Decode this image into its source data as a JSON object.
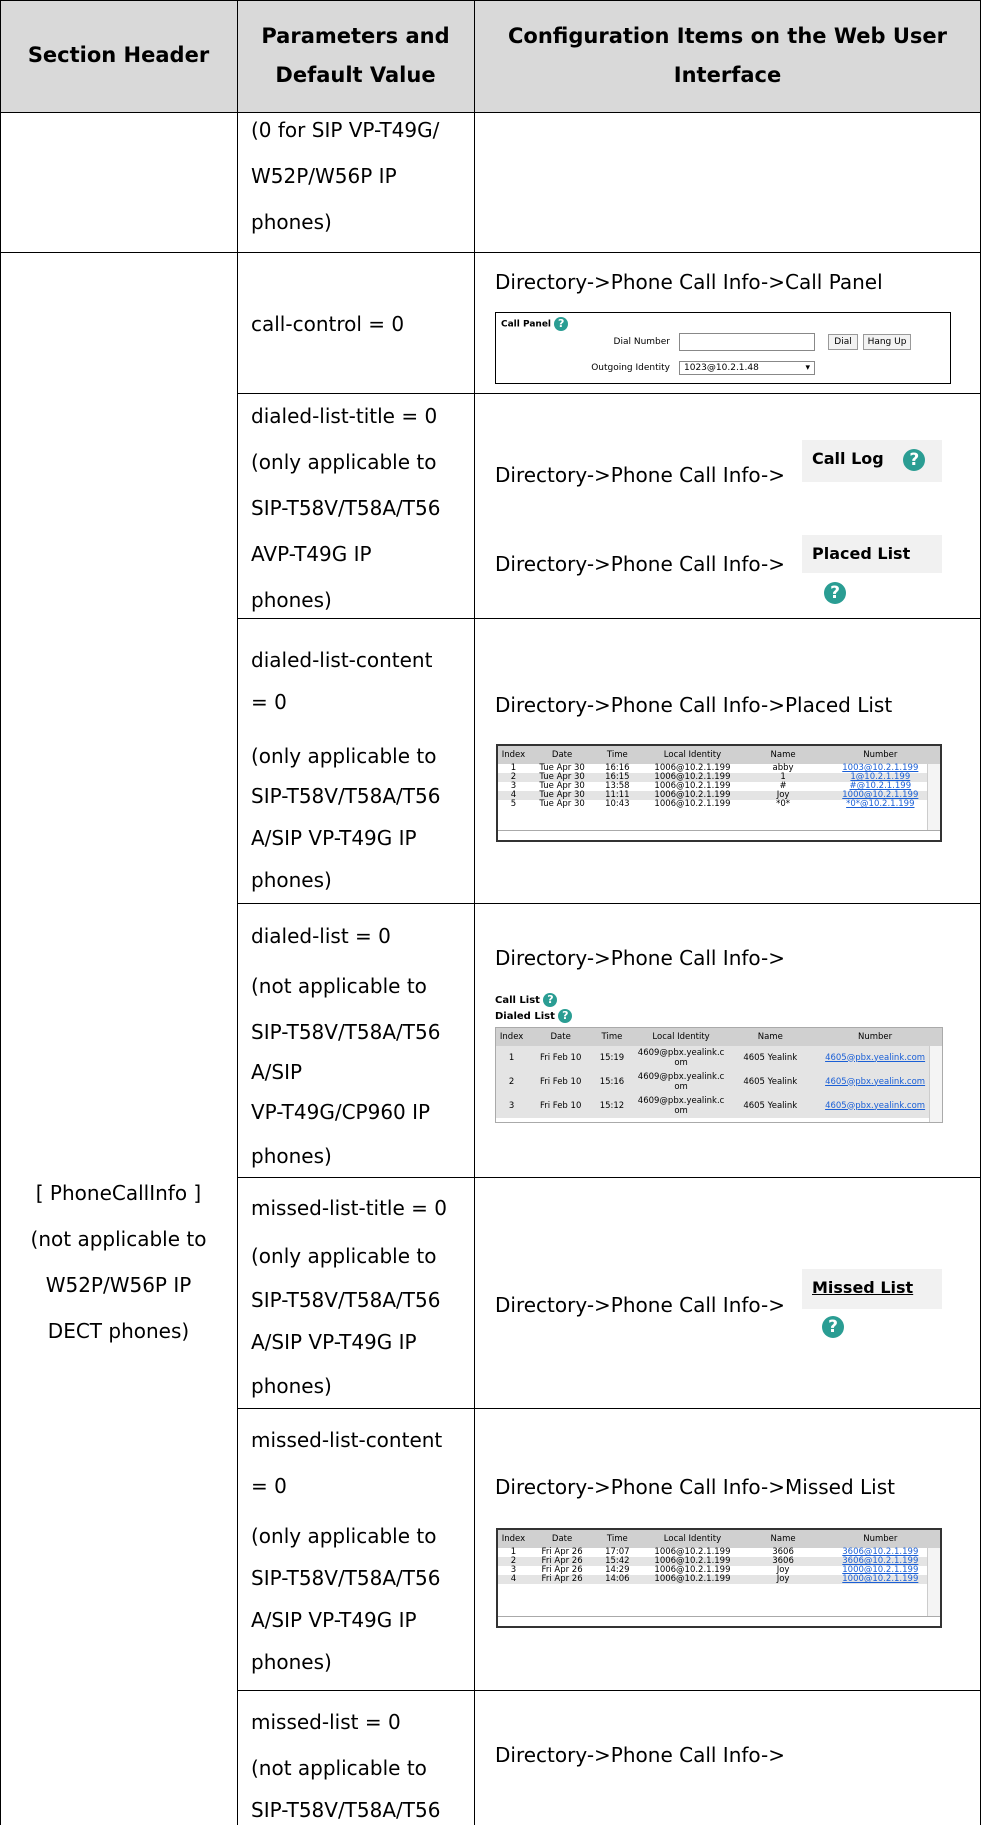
{
  "header": {
    "col1": "Section Header",
    "col2_line1": "Parameters and",
    "col2_line2": "Default Value",
    "col3_line1": "Configuration Items on the Web User",
    "col3_line2": "Interface"
  },
  "row0": {
    "param_lines": [
      "(0 for SIP VP-T49G/",
      "W52P/W56P IP",
      "phones)"
    ]
  },
  "section": {
    "lines": [
      "[ PhoneCallInfo ]",
      "(not applicable to",
      "W52P/W56P IP",
      "DECT phones)"
    ]
  },
  "rows": [
    {
      "param_lines": [
        "call-control = 0"
      ],
      "config": "Directory->Phone Call Info->Call Panel"
    },
    {
      "param_lines": [
        "dialed-list-title = 0",
        "(only applicable to",
        "SIP-T58V/T58A/T56",
        "AVP-T49G IP",
        "phones)"
      ],
      "config1": "Directory->Phone Call Info->",
      "config2": "Directory->Phone Call Info->"
    },
    {
      "param_lines": [
        "dialed-list-content",
        "= 0",
        "(only applicable to",
        "SIP-T58V/T58A/T56",
        "A/SIP VP-T49G IP",
        "phones)"
      ],
      "config": "Directory->Phone Call Info->Placed List"
    },
    {
      "param_lines": [
        "dialed-list = 0",
        "(not applicable to",
        "SIP-T58V/T58A/T56",
        "A/SIP",
        "VP-T49G/CP960 IP",
        "phones)"
      ],
      "config": "Directory->Phone Call Info->"
    },
    {
      "param_lines": [
        "missed-list-title = 0",
        "(only applicable to",
        "SIP-T58V/T58A/T56",
        "A/SIP VP-T49G IP",
        "phones)"
      ],
      "config": "Directory->Phone Call Info->"
    },
    {
      "param_lines": [
        "missed-list-content",
        "= 0",
        "(only applicable to",
        "SIP-T58V/T58A/T56",
        "A/SIP VP-T49G IP",
        "phones)"
      ],
      "config": "Directory->Phone Call Info->Missed List"
    },
    {
      "param_lines": [
        "missed-list = 0",
        "(not applicable to",
        "SIP-T58V/T58A/T56"
      ],
      "config": "Directory->Phone Call Info->"
    }
  ],
  "call_panel": {
    "title": "Call Panel",
    "dial_number_label": "Dial Number",
    "outgoing_identity_label": "Outgoing Identity",
    "outgoing_identity_value": "1023@10.2.1.48",
    "dial_button": "Dial",
    "hangup_button": "Hang Up"
  },
  "title_boxes": {
    "call_log": "Call Log",
    "placed_list": "Placed List",
    "missed_list": "Missed List",
    "help_icon": "help-circle-icon"
  },
  "placed_table": {
    "columns": [
      "Index",
      "Date",
      "Time",
      "Local Identity",
      "Name",
      "Number"
    ],
    "rows": [
      [
        "1",
        "Tue Apr 30",
        "16:16",
        "1006@10.2.1.199",
        "abby",
        "1003@10.2.1.199"
      ],
      [
        "2",
        "Tue Apr 30",
        "16:15",
        "1006@10.2.1.199",
        "1",
        "1@10.2.1.199"
      ],
      [
        "3",
        "Tue Apr 30",
        "13:58",
        "1006@10.2.1.199",
        "#",
        "#@10.2.1.199"
      ],
      [
        "4",
        "Tue Apr 30",
        "11:11",
        "1006@10.2.1.199",
        "Joy",
        "1000@10.2.1.199"
      ],
      [
        "5",
        "Tue Apr 30",
        "10:43",
        "1006@10.2.1.199",
        "*0*",
        "*0*@10.2.1.199"
      ]
    ]
  },
  "call_list_table": {
    "title1": "Call List",
    "title2": "Dialed List",
    "columns": [
      "Index",
      "Date",
      "Time",
      "Local Identity",
      "Name",
      "Number"
    ],
    "rows": [
      [
        "1",
        "Fri Feb 10",
        "15:19",
        "4609@pbx.yealink.c om",
        "4605 Yealink",
        "4605@pbx.yealink.com"
      ],
      [
        "2",
        "Fri Feb 10",
        "15:16",
        "4609@pbx.yealink.c om",
        "4605 Yealink",
        "4605@pbx.yealink.com"
      ],
      [
        "3",
        "Fri Feb 10",
        "15:12",
        "4609@pbx.yealink.c om",
        "4605 Yealink",
        "4605@pbx.yealink.com"
      ]
    ]
  },
  "missed_table": {
    "columns": [
      "Index",
      "Date",
      "Time",
      "Local Identity",
      "Name",
      "Number"
    ],
    "rows": [
      [
        "1",
        "Fri Apr 26",
        "17:07",
        "1006@10.2.1.199",
        "3606",
        "3606@10.2.1.199"
      ],
      [
        "2",
        "Fri Apr 26",
        "15:42",
        "1006@10.2.1.199",
        "3606",
        "3606@10.2.1.199"
      ],
      [
        "3",
        "Fri Apr 26",
        "14:29",
        "1006@10.2.1.199",
        "Joy",
        "1000@10.2.1.199"
      ],
      [
        "4",
        "Fri Apr 26",
        "14:06",
        "1006@10.2.1.199",
        "Joy",
        "1000@10.2.1.199"
      ]
    ]
  }
}
